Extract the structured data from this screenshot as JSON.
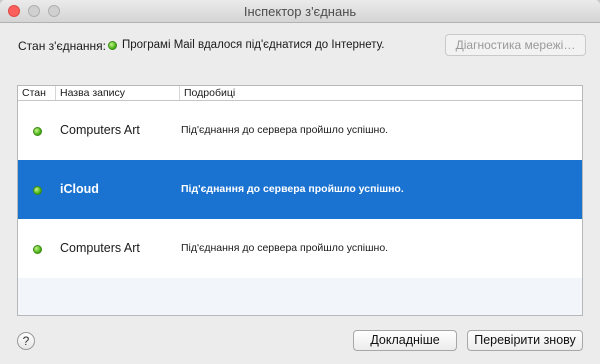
{
  "window": {
    "title": "Інспектор з'єднань"
  },
  "status": {
    "label": "Стан з'єднання:",
    "text": "Програмі Mail вдалося під'єднатися до Інтернету.",
    "indicator_color": "#4fb81b"
  },
  "toolbar": {
    "diagnostics_label": "Діагностика мережі…"
  },
  "table": {
    "columns": [
      "Стан",
      "Назва запису",
      "Подробиці"
    ],
    "rows": [
      {
        "status_icon": "green-status-icon",
        "name": "Computers Art",
        "detail": "Під'єднання до сервера пройшло успішно."
      },
      {
        "status_icon": "green-status-icon",
        "name": "iCloud",
        "detail": "Під'єднання до сервера пройшло успішно.",
        "selected": true
      },
      {
        "status_icon": "green-status-icon",
        "name": "Computers Art",
        "detail": "Під'єднання до сервера пройшло успішно."
      }
    ],
    "selection_color": "#1a73d1"
  },
  "footer": {
    "help_label": "?",
    "details_label": "Докладніше",
    "recheck_label": "Перевірити знову"
  }
}
